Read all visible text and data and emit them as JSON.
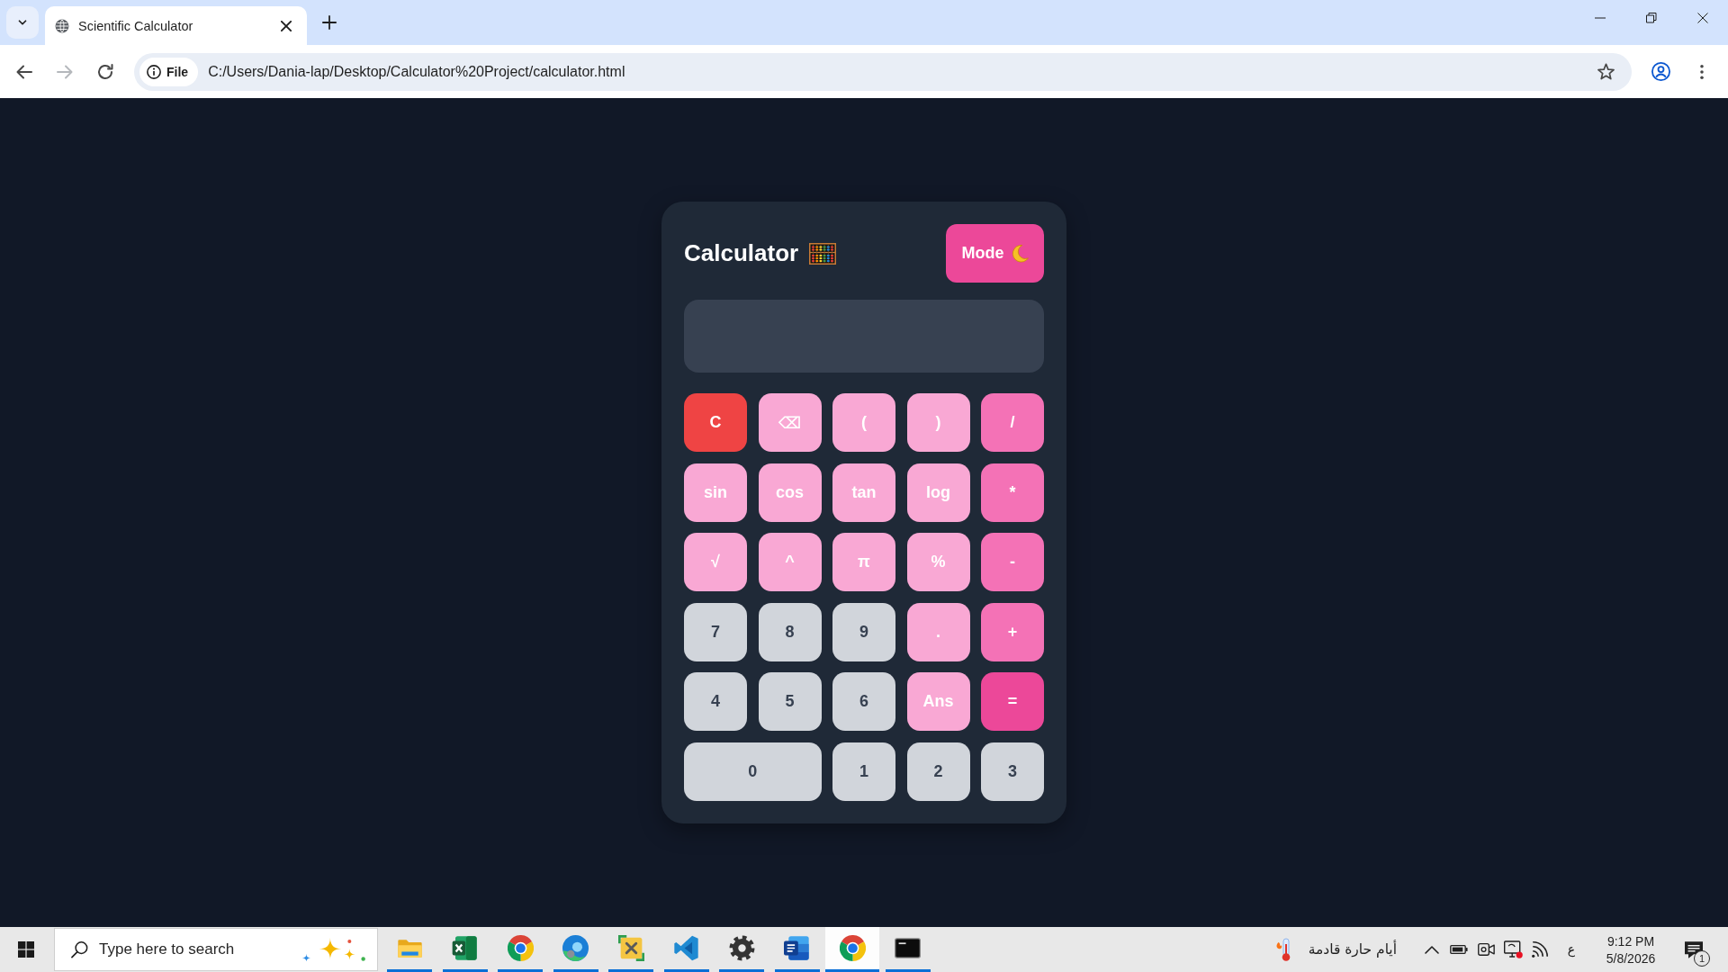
{
  "browser": {
    "tabs": [
      {
        "title": "Scientific Calculator",
        "selected": true
      }
    ],
    "nav_buttons": [
      {
        "kind": "back",
        "disabled": false
      },
      {
        "kind": "forward",
        "disabled": true
      },
      {
        "kind": "reload",
        "disabled": false
      }
    ],
    "address_bar": {
      "chip": "File",
      "url": "C:/Users/Dania-lap/Desktop/Calculator%20Project/calculator.html"
    }
  },
  "calculator": {
    "title": "Calculator",
    "mode_button": "Mode",
    "keys": [
      {
        "label": "C",
        "kind": "clear",
        "wide": false
      },
      {
        "label": "⌫",
        "kind": "function",
        "wide": false
      },
      {
        "label": "(",
        "kind": "function",
        "wide": false
      },
      {
        "label": ")",
        "kind": "function",
        "wide": false
      },
      {
        "label": "/",
        "kind": "operator",
        "wide": false
      },
      {
        "label": "sin",
        "kind": "function",
        "wide": false
      },
      {
        "label": "cos",
        "kind": "function",
        "wide": false
      },
      {
        "label": "tan",
        "kind": "function",
        "wide": false
      },
      {
        "label": "log",
        "kind": "function",
        "wide": false
      },
      {
        "label": "*",
        "kind": "operator",
        "wide": false
      },
      {
        "label": "√",
        "kind": "function",
        "wide": false
      },
      {
        "label": "^",
        "kind": "function",
        "wide": false
      },
      {
        "label": "π",
        "kind": "function",
        "wide": false
      },
      {
        "label": "%",
        "kind": "function",
        "wide": false
      },
      {
        "label": "-",
        "kind": "operator",
        "wide": false
      },
      {
        "label": "7",
        "kind": "digit",
        "wide": false
      },
      {
        "label": "8",
        "kind": "digit",
        "wide": false
      },
      {
        "label": "9",
        "kind": "digit",
        "wide": false
      },
      {
        "label": ".",
        "kind": "function",
        "wide": false
      },
      {
        "label": "+",
        "kind": "operator",
        "wide": false
      },
      {
        "label": "4",
        "kind": "digit",
        "wide": false
      },
      {
        "label": "5",
        "kind": "digit",
        "wide": false
      },
      {
        "label": "6",
        "kind": "digit",
        "wide": false
      },
      {
        "label": "Ans",
        "kind": "function",
        "wide": false
      },
      {
        "label": "=",
        "kind": "equals",
        "wide": false
      },
      {
        "label": "0",
        "kind": "digit",
        "wide": true
      },
      {
        "label": "1",
        "kind": "digit",
        "wide": false
      },
      {
        "label": "2",
        "kind": "digit",
        "wide": false
      },
      {
        "label": "3",
        "kind": "digit",
        "wide": false
      }
    ]
  },
  "taskbar": {
    "search": {
      "placeholder": "Type here to search"
    },
    "apps": [
      {
        "kind": "folder",
        "running": true,
        "selected": false
      },
      {
        "kind": "spreadsheet",
        "running": true,
        "selected": false
      },
      {
        "kind": "ring",
        "running": true,
        "selected": false
      },
      {
        "kind": "swirl",
        "running": true,
        "selected": false
      },
      {
        "kind": "tools",
        "running": true,
        "selected": false
      },
      {
        "kind": "ribbon",
        "running": true,
        "selected": false
      },
      {
        "kind": "gear",
        "running": true,
        "selected": false
      },
      {
        "kind": "document",
        "running": true,
        "selected": false
      },
      {
        "kind": "ring",
        "running": true,
        "selected": true
      },
      {
        "kind": "terminal",
        "running": true,
        "selected": false
      }
    ],
    "weather": "أيام حارة قادمة",
    "input_language": "ع",
    "time": "9:12 PM",
    "date": "5/8/2026",
    "notification_count": "1"
  }
}
